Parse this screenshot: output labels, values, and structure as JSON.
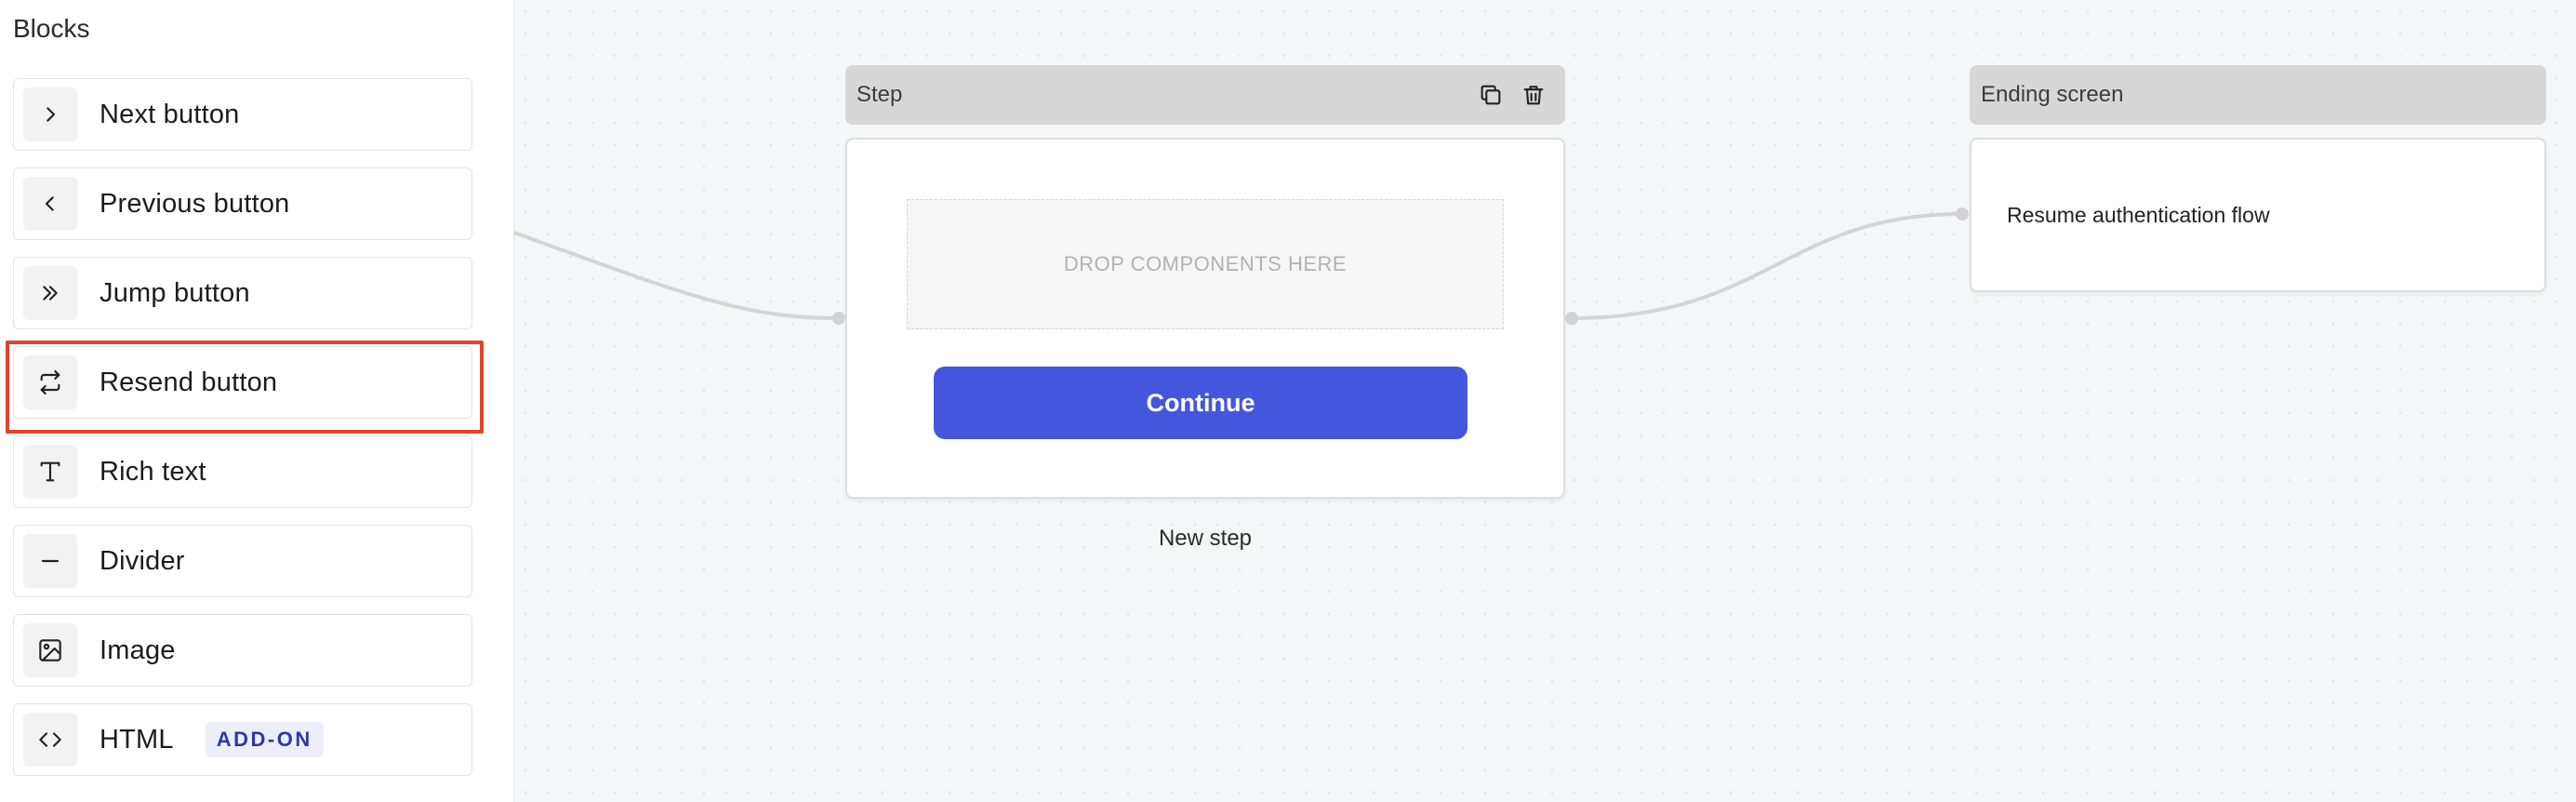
{
  "sidebar": {
    "title": "Blocks",
    "items": [
      {
        "label": "Next button",
        "icon": "chevron-right-icon"
      },
      {
        "label": "Previous button",
        "icon": "chevron-left-icon"
      },
      {
        "label": "Jump button",
        "icon": "double-chevron-right-icon"
      },
      {
        "label": "Resend button",
        "icon": "repeat-arrows-icon",
        "highlighted": true
      },
      {
        "label": "Rich text",
        "icon": "text-icon"
      },
      {
        "label": "Divider",
        "icon": "minus-icon"
      },
      {
        "label": "Image",
        "icon": "image-icon"
      },
      {
        "label": "HTML",
        "icon": "code-icon",
        "badge": "ADD-ON"
      }
    ]
  },
  "step_node": {
    "header_title": "Step",
    "dropzone_text": "DROP COMPONENTS HERE",
    "continue_label": "Continue",
    "caption": "New step"
  },
  "ending_node": {
    "header_title": "Ending screen",
    "body_text": "Resume authentication flow"
  },
  "colors": {
    "accent": "#4456dd",
    "highlight": "#e0442c",
    "badge_bg": "#eceefb",
    "badge_text": "#2b3aa8"
  }
}
